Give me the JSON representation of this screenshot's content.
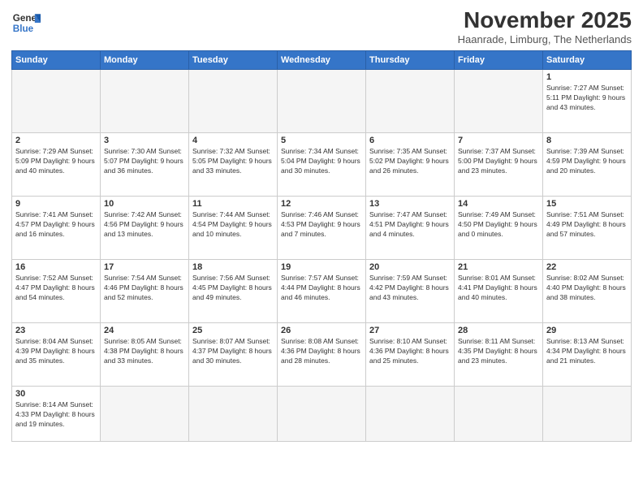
{
  "logo": {
    "line1": "General",
    "line2": "Blue"
  },
  "title": "November 2025",
  "subtitle": "Haanrade, Limburg, The Netherlands",
  "days_header": [
    "Sunday",
    "Monday",
    "Tuesday",
    "Wednesday",
    "Thursday",
    "Friday",
    "Saturday"
  ],
  "weeks": [
    [
      {
        "day": "",
        "info": ""
      },
      {
        "day": "",
        "info": ""
      },
      {
        "day": "",
        "info": ""
      },
      {
        "day": "",
        "info": ""
      },
      {
        "day": "",
        "info": ""
      },
      {
        "day": "",
        "info": ""
      },
      {
        "day": "1",
        "info": "Sunrise: 7:27 AM\nSunset: 5:11 PM\nDaylight: 9 hours and 43 minutes."
      }
    ],
    [
      {
        "day": "2",
        "info": "Sunrise: 7:29 AM\nSunset: 5:09 PM\nDaylight: 9 hours and 40 minutes."
      },
      {
        "day": "3",
        "info": "Sunrise: 7:30 AM\nSunset: 5:07 PM\nDaylight: 9 hours and 36 minutes."
      },
      {
        "day": "4",
        "info": "Sunrise: 7:32 AM\nSunset: 5:05 PM\nDaylight: 9 hours and 33 minutes."
      },
      {
        "day": "5",
        "info": "Sunrise: 7:34 AM\nSunset: 5:04 PM\nDaylight: 9 hours and 30 minutes."
      },
      {
        "day": "6",
        "info": "Sunrise: 7:35 AM\nSunset: 5:02 PM\nDaylight: 9 hours and 26 minutes."
      },
      {
        "day": "7",
        "info": "Sunrise: 7:37 AM\nSunset: 5:00 PM\nDaylight: 9 hours and 23 minutes."
      },
      {
        "day": "8",
        "info": "Sunrise: 7:39 AM\nSunset: 4:59 PM\nDaylight: 9 hours and 20 minutes."
      }
    ],
    [
      {
        "day": "9",
        "info": "Sunrise: 7:41 AM\nSunset: 4:57 PM\nDaylight: 9 hours and 16 minutes."
      },
      {
        "day": "10",
        "info": "Sunrise: 7:42 AM\nSunset: 4:56 PM\nDaylight: 9 hours and 13 minutes."
      },
      {
        "day": "11",
        "info": "Sunrise: 7:44 AM\nSunset: 4:54 PM\nDaylight: 9 hours and 10 minutes."
      },
      {
        "day": "12",
        "info": "Sunrise: 7:46 AM\nSunset: 4:53 PM\nDaylight: 9 hours and 7 minutes."
      },
      {
        "day": "13",
        "info": "Sunrise: 7:47 AM\nSunset: 4:51 PM\nDaylight: 9 hours and 4 minutes."
      },
      {
        "day": "14",
        "info": "Sunrise: 7:49 AM\nSunset: 4:50 PM\nDaylight: 9 hours and 0 minutes."
      },
      {
        "day": "15",
        "info": "Sunrise: 7:51 AM\nSunset: 4:49 PM\nDaylight: 8 hours and 57 minutes."
      }
    ],
    [
      {
        "day": "16",
        "info": "Sunrise: 7:52 AM\nSunset: 4:47 PM\nDaylight: 8 hours and 54 minutes."
      },
      {
        "day": "17",
        "info": "Sunrise: 7:54 AM\nSunset: 4:46 PM\nDaylight: 8 hours and 52 minutes."
      },
      {
        "day": "18",
        "info": "Sunrise: 7:56 AM\nSunset: 4:45 PM\nDaylight: 8 hours and 49 minutes."
      },
      {
        "day": "19",
        "info": "Sunrise: 7:57 AM\nSunset: 4:44 PM\nDaylight: 8 hours and 46 minutes."
      },
      {
        "day": "20",
        "info": "Sunrise: 7:59 AM\nSunset: 4:42 PM\nDaylight: 8 hours and 43 minutes."
      },
      {
        "day": "21",
        "info": "Sunrise: 8:01 AM\nSunset: 4:41 PM\nDaylight: 8 hours and 40 minutes."
      },
      {
        "day": "22",
        "info": "Sunrise: 8:02 AM\nSunset: 4:40 PM\nDaylight: 8 hours and 38 minutes."
      }
    ],
    [
      {
        "day": "23",
        "info": "Sunrise: 8:04 AM\nSunset: 4:39 PM\nDaylight: 8 hours and 35 minutes."
      },
      {
        "day": "24",
        "info": "Sunrise: 8:05 AM\nSunset: 4:38 PM\nDaylight: 8 hours and 33 minutes."
      },
      {
        "day": "25",
        "info": "Sunrise: 8:07 AM\nSunset: 4:37 PM\nDaylight: 8 hours and 30 minutes."
      },
      {
        "day": "26",
        "info": "Sunrise: 8:08 AM\nSunset: 4:36 PM\nDaylight: 8 hours and 28 minutes."
      },
      {
        "day": "27",
        "info": "Sunrise: 8:10 AM\nSunset: 4:36 PM\nDaylight: 8 hours and 25 minutes."
      },
      {
        "day": "28",
        "info": "Sunrise: 8:11 AM\nSunset: 4:35 PM\nDaylight: 8 hours and 23 minutes."
      },
      {
        "day": "29",
        "info": "Sunrise: 8:13 AM\nSunset: 4:34 PM\nDaylight: 8 hours and 21 minutes."
      }
    ],
    [
      {
        "day": "30",
        "info": "Sunrise: 8:14 AM\nSunset: 4:33 PM\nDaylight: 8 hours and 19 minutes."
      },
      {
        "day": "",
        "info": ""
      },
      {
        "day": "",
        "info": ""
      },
      {
        "day": "",
        "info": ""
      },
      {
        "day": "",
        "info": ""
      },
      {
        "day": "",
        "info": ""
      },
      {
        "day": "",
        "info": ""
      }
    ]
  ]
}
